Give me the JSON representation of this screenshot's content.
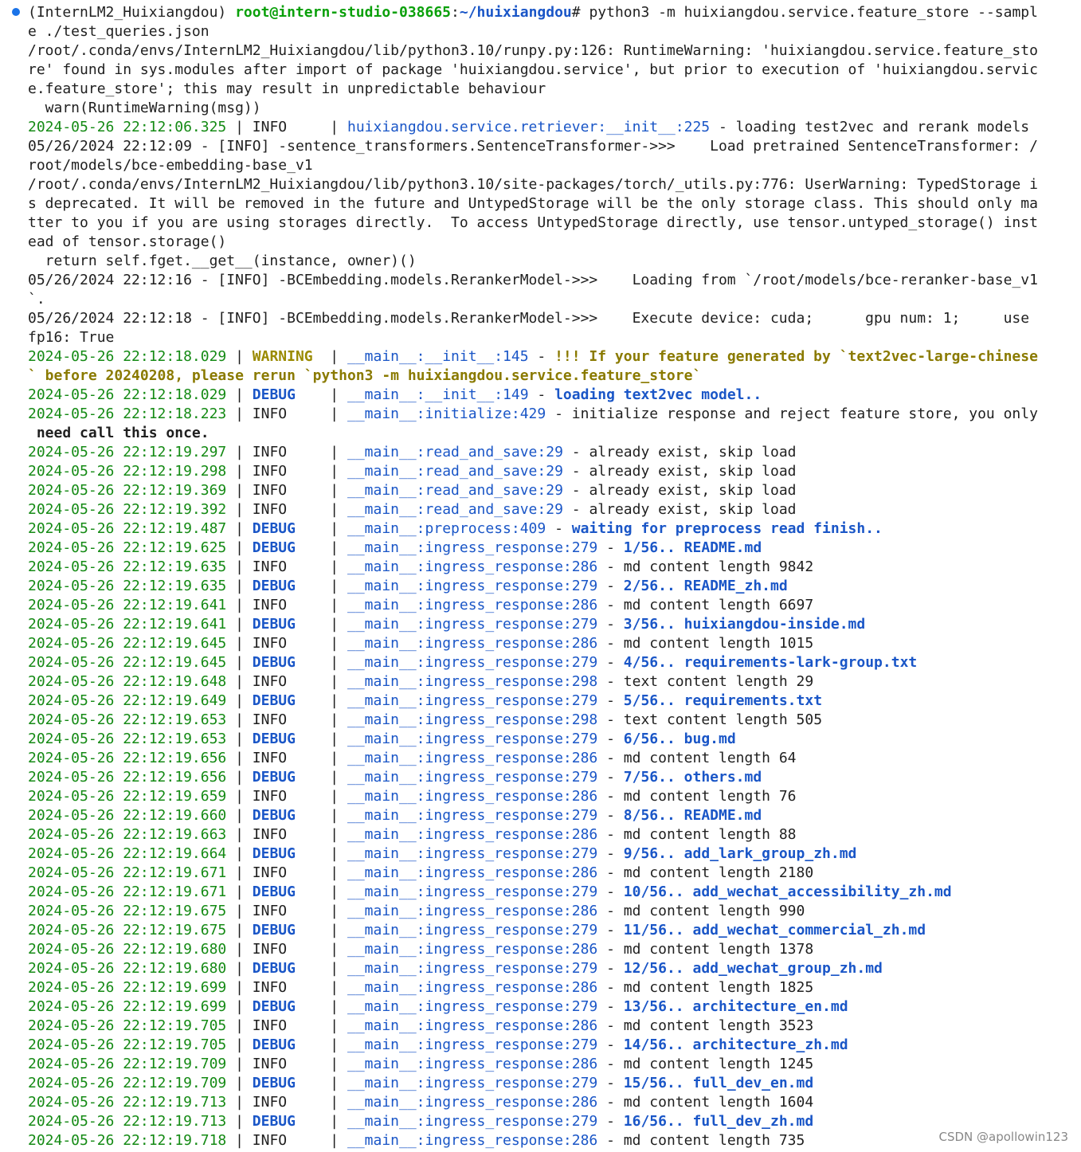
{
  "prompt": {
    "env": "(InternLM2_Huixiangdou) ",
    "user": "root@intern-studio-038665",
    "sep": ":",
    "path": "~/huixiangdou",
    "cmd": "# python3 -m huixiangdou.service.feature_store --sampl",
    "cmd_cont": "e ./test_queries.json"
  },
  "plain_lines": {
    "l2": "/root/.conda/envs/InternLM2_Huixiangdou/lib/python3.10/runpy.py:126: RuntimeWarning: 'huixiangdou.service.feature_sto",
    "l3": "re' found in sys.modules after import of package 'huixiangdou.service', but prior to execution of 'huixiangdou.servic",
    "l4": "e.feature_store'; this may result in unpredictable behaviour",
    "l5": "  warn(RuntimeWarning(msg))",
    "l7": "05/26/2024 22:12:09 - [INFO] -sentence_transformers.SentenceTransformer->>>    Load pretrained SentenceTransformer: /",
    "l8": "root/models/bce-embedding-base_v1",
    "l9": "/root/.conda/envs/InternLM2_Huixiangdou/lib/python3.10/site-packages/torch/_utils.py:776: UserWarning: TypedStorage i",
    "l10": "s deprecated. It will be removed in the future and UntypedStorage will be the only storage class. This should only ma",
    "l11": "tter to you if you are using storages directly.  To access UntypedStorage directly, use tensor.untyped_storage() inst",
    "l12": "ead of tensor.storage()",
    "l13": "  return self.fget.__get__(instance, owner)()",
    "l14": "05/26/2024 22:12:16 - [INFO] -BCEmbedding.models.RerankerModel->>>    Loading from `/root/models/bce-reranker-base_v1",
    "l15": "`.",
    "l16": "05/26/2024 22:12:18 - [INFO] -BCEmbedding.models.RerankerModel->>>    Execute device: cuda;      gpu num: 1;     use",
    "l17": "fp16: True",
    "l19": "` before 20240208, please rerun `python3 -m huixiangdou.service.feature_store`",
    "l22": " need call this once."
  },
  "log_entries": [
    {
      "ts": "2024-05-26 22:12:06.325",
      "lvl": "INFO    ",
      "mod": "huixiangdou.service.retriever:__init__:225",
      "msg": "loading test2vec and rerank models",
      "row": 6
    },
    {
      "ts": "2024-05-26 22:12:18.029",
      "lvl": "WARNING ",
      "mod": "__main__:__init__:145",
      "msg": "!!! If your feature generated by `text2vec-large-chinese",
      "row": 18
    },
    {
      "ts": "2024-05-26 22:12:18.029",
      "lvl": "DEBUG   ",
      "mod": "__main__:__init__:149",
      "msg": "loading text2vec model..",
      "row": 20
    },
    {
      "ts": "2024-05-26 22:12:18.223",
      "lvl": "INFO    ",
      "mod": "__main__:initialize:429",
      "msg": "initialize response and reject feature store, you only",
      "row": 21
    },
    {
      "ts": "2024-05-26 22:12:19.297",
      "lvl": "INFO    ",
      "mod": "__main__:read_and_save:29",
      "msg": "already exist, skip load",
      "row": 23
    },
    {
      "ts": "2024-05-26 22:12:19.298",
      "lvl": "INFO    ",
      "mod": "__main__:read_and_save:29",
      "msg": "already exist, skip load",
      "row": 24
    },
    {
      "ts": "2024-05-26 22:12:19.369",
      "lvl": "INFO    ",
      "mod": "__main__:read_and_save:29",
      "msg": "already exist, skip load",
      "row": 25
    },
    {
      "ts": "2024-05-26 22:12:19.392",
      "lvl": "INFO    ",
      "mod": "__main__:read_and_save:29",
      "msg": "already exist, skip load",
      "row": 26
    },
    {
      "ts": "2024-05-26 22:12:19.487",
      "lvl": "DEBUG   ",
      "mod": "__main__:preprocess:409",
      "msg": "waiting for preprocess read finish..",
      "row": 27
    },
    {
      "ts": "2024-05-26 22:12:19.625",
      "lvl": "DEBUG   ",
      "mod": "__main__:ingress_response:279",
      "msg": "1/56.. README.md",
      "row": 28
    },
    {
      "ts": "2024-05-26 22:12:19.635",
      "lvl": "INFO    ",
      "mod": "__main__:ingress_response:286",
      "msg": "md content length 9842",
      "row": 29
    },
    {
      "ts": "2024-05-26 22:12:19.635",
      "lvl": "DEBUG   ",
      "mod": "__main__:ingress_response:279",
      "msg": "2/56.. README_zh.md",
      "row": 30
    },
    {
      "ts": "2024-05-26 22:12:19.641",
      "lvl": "INFO    ",
      "mod": "__main__:ingress_response:286",
      "msg": "md content length 6697",
      "row": 31
    },
    {
      "ts": "2024-05-26 22:12:19.641",
      "lvl": "DEBUG   ",
      "mod": "__main__:ingress_response:279",
      "msg": "3/56.. huixiangdou-inside.md",
      "row": 32
    },
    {
      "ts": "2024-05-26 22:12:19.645",
      "lvl": "INFO    ",
      "mod": "__main__:ingress_response:286",
      "msg": "md content length 1015",
      "row": 33
    },
    {
      "ts": "2024-05-26 22:12:19.645",
      "lvl": "DEBUG   ",
      "mod": "__main__:ingress_response:279",
      "msg": "4/56.. requirements-lark-group.txt",
      "row": 34
    },
    {
      "ts": "2024-05-26 22:12:19.648",
      "lvl": "INFO    ",
      "mod": "__main__:ingress_response:298",
      "msg": "text content length 29",
      "row": 35
    },
    {
      "ts": "2024-05-26 22:12:19.649",
      "lvl": "DEBUG   ",
      "mod": "__main__:ingress_response:279",
      "msg": "5/56.. requirements.txt",
      "row": 36
    },
    {
      "ts": "2024-05-26 22:12:19.653",
      "lvl": "INFO    ",
      "mod": "__main__:ingress_response:298",
      "msg": "text content length 505",
      "row": 37
    },
    {
      "ts": "2024-05-26 22:12:19.653",
      "lvl": "DEBUG   ",
      "mod": "__main__:ingress_response:279",
      "msg": "6/56.. bug.md",
      "row": 38
    },
    {
      "ts": "2024-05-26 22:12:19.656",
      "lvl": "INFO    ",
      "mod": "__main__:ingress_response:286",
      "msg": "md content length 64",
      "row": 39
    },
    {
      "ts": "2024-05-26 22:12:19.656",
      "lvl": "DEBUG   ",
      "mod": "__main__:ingress_response:279",
      "msg": "7/56.. others.md",
      "row": 40
    },
    {
      "ts": "2024-05-26 22:12:19.659",
      "lvl": "INFO    ",
      "mod": "__main__:ingress_response:286",
      "msg": "md content length 76",
      "row": 41
    },
    {
      "ts": "2024-05-26 22:12:19.660",
      "lvl": "DEBUG   ",
      "mod": "__main__:ingress_response:279",
      "msg": "8/56.. README.md",
      "row": 42
    },
    {
      "ts": "2024-05-26 22:12:19.663",
      "lvl": "INFO    ",
      "mod": "__main__:ingress_response:286",
      "msg": "md content length 88",
      "row": 43
    },
    {
      "ts": "2024-05-26 22:12:19.664",
      "lvl": "DEBUG   ",
      "mod": "__main__:ingress_response:279",
      "msg": "9/56.. add_lark_group_zh.md",
      "row": 44
    },
    {
      "ts": "2024-05-26 22:12:19.671",
      "lvl": "INFO    ",
      "mod": "__main__:ingress_response:286",
      "msg": "md content length 2180",
      "row": 45
    },
    {
      "ts": "2024-05-26 22:12:19.671",
      "lvl": "DEBUG   ",
      "mod": "__main__:ingress_response:279",
      "msg": "10/56.. add_wechat_accessibility_zh.md",
      "row": 46
    },
    {
      "ts": "2024-05-26 22:12:19.675",
      "lvl": "INFO    ",
      "mod": "__main__:ingress_response:286",
      "msg": "md content length 990",
      "row": 47
    },
    {
      "ts": "2024-05-26 22:12:19.675",
      "lvl": "DEBUG   ",
      "mod": "__main__:ingress_response:279",
      "msg": "11/56.. add_wechat_commercial_zh.md",
      "row": 48
    },
    {
      "ts": "2024-05-26 22:12:19.680",
      "lvl": "INFO    ",
      "mod": "__main__:ingress_response:286",
      "msg": "md content length 1378",
      "row": 49
    },
    {
      "ts": "2024-05-26 22:12:19.680",
      "lvl": "DEBUG   ",
      "mod": "__main__:ingress_response:279",
      "msg": "12/56.. add_wechat_group_zh.md",
      "row": 50
    },
    {
      "ts": "2024-05-26 22:12:19.699",
      "lvl": "INFO    ",
      "mod": "__main__:ingress_response:286",
      "msg": "md content length 1825",
      "row": 51
    },
    {
      "ts": "2024-05-26 22:12:19.699",
      "lvl": "DEBUG   ",
      "mod": "__main__:ingress_response:279",
      "msg": "13/56.. architecture_en.md",
      "row": 52
    },
    {
      "ts": "2024-05-26 22:12:19.705",
      "lvl": "INFO    ",
      "mod": "__main__:ingress_response:286",
      "msg": "md content length 3523",
      "row": 53
    },
    {
      "ts": "2024-05-26 22:12:19.705",
      "lvl": "DEBUG   ",
      "mod": "__main__:ingress_response:279",
      "msg": "14/56.. architecture_zh.md",
      "row": 54
    },
    {
      "ts": "2024-05-26 22:12:19.709",
      "lvl": "INFO    ",
      "mod": "__main__:ingress_response:286",
      "msg": "md content length 1245",
      "row": 55
    },
    {
      "ts": "2024-05-26 22:12:19.709",
      "lvl": "DEBUG   ",
      "mod": "__main__:ingress_response:279",
      "msg": "15/56.. full_dev_en.md",
      "row": 56
    },
    {
      "ts": "2024-05-26 22:12:19.713",
      "lvl": "INFO    ",
      "mod": "__main__:ingress_response:286",
      "msg": "md content length 1604",
      "row": 57
    },
    {
      "ts": "2024-05-26 22:12:19.713",
      "lvl": "DEBUG   ",
      "mod": "__main__:ingress_response:279",
      "msg": "16/56.. full_dev_zh.md",
      "row": 58
    },
    {
      "ts": "2024-05-26 22:12:19.718",
      "lvl": "INFO    ",
      "mod": "__main__:ingress_response:286",
      "msg": "md content length 735",
      "row": 59
    }
  ],
  "watermark": "CSDN @apollowin123",
  "colors": {
    "timestamp": "#148a14",
    "debug": "#1a56c7",
    "warning": "#9a8a00",
    "prompt_user": "#0aa00a"
  }
}
